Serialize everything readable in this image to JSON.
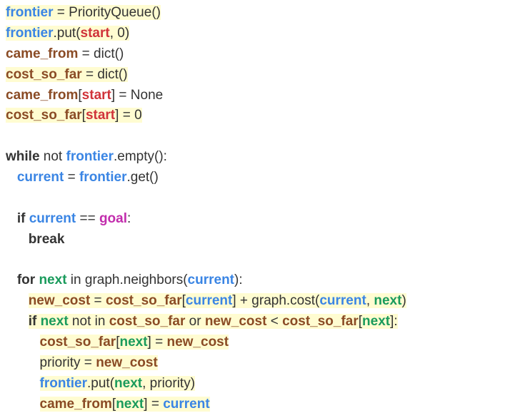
{
  "t": {
    "frontier": "frontier",
    "PriorityQueue": "PriorityQueue()",
    "put": ".put(",
    "start": "start",
    "comma0": ", 0)",
    "came_from": "came_from",
    "cost_so_far": "cost_so_far",
    "eq_dict": " = dict()",
    "lbr": "[",
    "rbr_none": "] = None",
    "rbr_zero": "] = 0",
    "rbr_eq": "] = ",
    "rbr_colon": "]:",
    "rbr_plain": "]",
    "rbr_close": "] + ",
    "while": "while",
    "not": " not ",
    "empty": ".empty():",
    "current": "current",
    "eq": " = ",
    "get": ".get()",
    "if": "if",
    "eqeq": " == ",
    "goal": "goal",
    "colon": ":",
    "break": "break",
    "for": "for",
    "next": "next",
    "in": " in ",
    "graph_neighbors": "graph.neighbors(",
    "close_colon": "):",
    "new_cost": "new_cost",
    "graph_cost": "graph.cost(",
    "comma": ", ",
    "close_paren": ")",
    "not_in": " not in ",
    "or": " or ",
    "lt": " < ",
    "priority": "priority",
    "priority_close": ", priority)"
  },
  "lines": [
    "frontier = PriorityQueue()",
    "frontier.put(start, 0)",
    "came_from = dict()",
    "cost_so_far = dict()",
    "came_from[start] = None",
    "cost_so_far[start] = 0",
    "",
    "while not frontier.empty():",
    "   current = frontier.get()",
    "",
    "   if current == goal:",
    "      break",
    "",
    "   for next in graph.neighbors(current):",
    "      new_cost = cost_so_far[current] + graph.cost(current, next)",
    "      if next not in cost_so_far or new_cost < cost_so_far[next]:",
    "         cost_so_far[next] = new_cost",
    "         priority = new_cost",
    "         frontier.put(next, priority)",
    "         came_from[next] = current"
  ]
}
